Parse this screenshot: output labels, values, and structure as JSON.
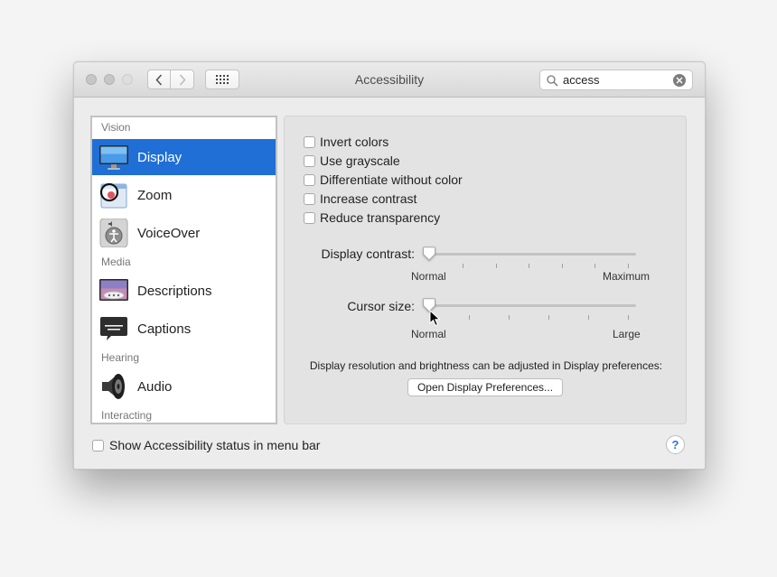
{
  "window": {
    "title": "Accessibility"
  },
  "search": {
    "value": "access"
  },
  "sidebar": {
    "sections": [
      {
        "header": "Vision",
        "items": [
          {
            "label": "Display",
            "icon": "display-icon",
            "selected": true
          },
          {
            "label": "Zoom",
            "icon": "zoom-icon"
          },
          {
            "label": "VoiceOver",
            "icon": "voiceover-icon"
          }
        ]
      },
      {
        "header": "Media",
        "items": [
          {
            "label": "Descriptions",
            "icon": "descriptions-icon"
          },
          {
            "label": "Captions",
            "icon": "captions-icon"
          }
        ]
      },
      {
        "header": "Hearing",
        "items": [
          {
            "label": "Audio",
            "icon": "speaker-icon"
          }
        ]
      },
      {
        "header": "Interacting",
        "items": []
      }
    ]
  },
  "panel": {
    "checkboxes": [
      {
        "label": "Invert colors",
        "checked": false
      },
      {
        "label": "Use grayscale",
        "checked": false
      },
      {
        "label": "Differentiate without color",
        "checked": false
      },
      {
        "label": "Increase contrast",
        "checked": false
      },
      {
        "label": "Reduce transparency",
        "checked": false
      }
    ],
    "display_contrast": {
      "label": "Display contrast:",
      "min_label": "Normal",
      "max_label": "Maximum",
      "value": 0
    },
    "cursor_size": {
      "label": "Cursor size:",
      "min_label": "Normal",
      "max_label": "Large",
      "value": 0
    },
    "note": "Display resolution and brightness can be adjusted in Display preferences:",
    "open_button": "Open Display Preferences..."
  },
  "footer": {
    "show_status_label": "Show Accessibility status in menu bar",
    "show_status_checked": false,
    "help": "?"
  },
  "colors": {
    "selection": "#1f6fd6",
    "help_accent": "#2f74d0"
  }
}
